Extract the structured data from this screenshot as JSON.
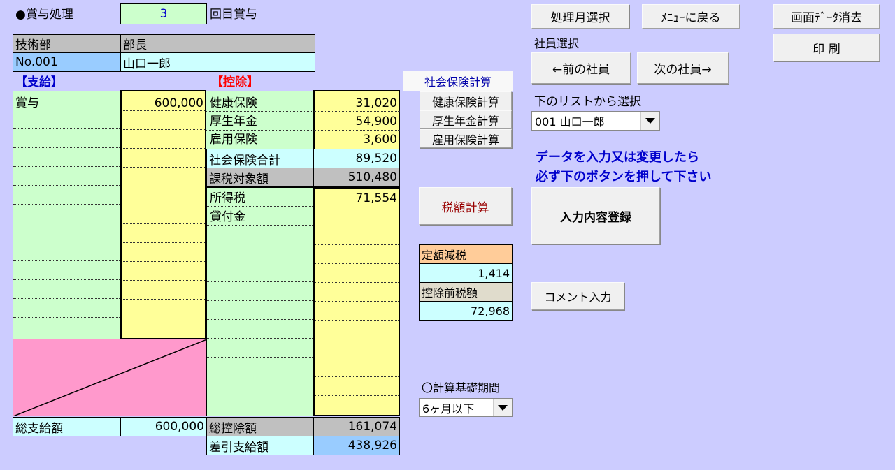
{
  "header": {
    "title": "●賞与処理",
    "times_value": "3",
    "times_suffix": "回目賞与"
  },
  "employee": {
    "department": "技術部",
    "position": "部長",
    "number": "No.001",
    "name": "山口一郎"
  },
  "payments": {
    "heading": "【支給】",
    "rows": [
      {
        "label": "賞与",
        "value": "600,000"
      }
    ],
    "total_label": "総支給額",
    "total_value": "600,000"
  },
  "deductions": {
    "heading": "【控除】",
    "health_label": "健康保険",
    "health_value": "31,020",
    "pension_label": "厚生年金",
    "pension_value": "54,900",
    "employment_label": "雇用保険",
    "employment_value": "3,600",
    "social_total_label": "社会保険合計",
    "social_total_value": "89,520",
    "taxable_label": "課税対象額",
    "taxable_value": "510,480",
    "income_tax_label": "所得税",
    "income_tax_value": "71,554",
    "loan_label": "貸付金",
    "total_label": "総控除額",
    "total_value": "161,074",
    "net_label": "差引支給額",
    "net_value": "438,926"
  },
  "insurance_panel": {
    "title": "社会保険計算",
    "health_button": "健康保険計算",
    "pension_button": "厚生年金計算",
    "employment_button": "雇用保険計算"
  },
  "tax_button": "税額計算",
  "tax_reduction": {
    "label": "定額減税",
    "value": "1,414",
    "pre_label": "控除前税額",
    "pre_value": "72,968"
  },
  "period": {
    "label": "〇計算基礎期間",
    "selected": "6ヶ月以下"
  },
  "toolbar": {
    "month_select": "処理月選択",
    "back_to_menu": "ﾒﾆｭｰに戻る",
    "clear_screen": "画面ﾃﾞｰﾀ消去",
    "print": "印 刷"
  },
  "employee_select": {
    "label": "社員選択",
    "prev_button": "←前の社員",
    "next_button": "次の社員→",
    "list_label": "下のリストから選択",
    "selected": "001 山口一郎"
  },
  "notice": {
    "line1": "データを入力又は変更したら",
    "line2": "必ず下のボタンを押して下さい"
  },
  "register_button": "入力内容登録",
  "comment_button": "コメント入力",
  "colors": {
    "background": "#ccccff",
    "green": "#ccffcc",
    "yellow": "#ffff99",
    "cyan": "#ccffff",
    "pink": "#ff99cc",
    "notice": "#0000cc",
    "deduction_heading": "#ff0000"
  }
}
